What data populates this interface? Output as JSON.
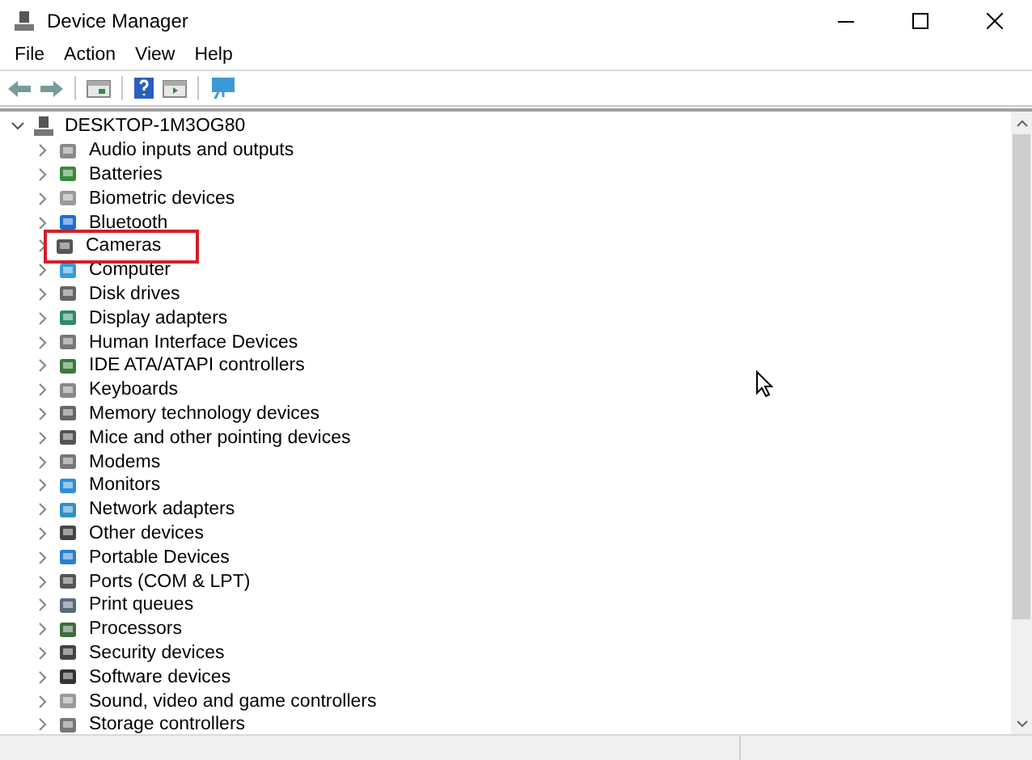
{
  "window": {
    "title": "Device Manager"
  },
  "menu": [
    "File",
    "Action",
    "View",
    "Help"
  ],
  "tree": {
    "label": "DESKTOP-1M3OG80",
    "expanded": true,
    "children": [
      {
        "label": "Audio inputs and outputs",
        "expanded": false,
        "highlighted": false
      },
      {
        "label": "Batteries",
        "expanded": false,
        "highlighted": false
      },
      {
        "label": "Biometric devices",
        "expanded": false,
        "highlighted": false
      },
      {
        "label": "Bluetooth",
        "expanded": false,
        "highlighted": false
      },
      {
        "label": "Cameras",
        "expanded": false,
        "highlighted": true
      },
      {
        "label": "Computer",
        "expanded": false,
        "highlighted": false
      },
      {
        "label": "Disk drives",
        "expanded": false,
        "highlighted": false
      },
      {
        "label": "Display adapters",
        "expanded": false,
        "highlighted": false
      },
      {
        "label": "Human Interface Devices",
        "expanded": false,
        "highlighted": false
      },
      {
        "label": "IDE ATA/ATAPI controllers",
        "expanded": false,
        "highlighted": false
      },
      {
        "label": "Keyboards",
        "expanded": false,
        "highlighted": false
      },
      {
        "label": "Memory technology devices",
        "expanded": false,
        "highlighted": false
      },
      {
        "label": "Mice and other pointing devices",
        "expanded": false,
        "highlighted": false
      },
      {
        "label": "Modems",
        "expanded": false,
        "highlighted": false
      },
      {
        "label": "Monitors",
        "expanded": false,
        "highlighted": false
      },
      {
        "label": "Network adapters",
        "expanded": false,
        "highlighted": false
      },
      {
        "label": "Other devices",
        "expanded": false,
        "highlighted": false
      },
      {
        "label": "Portable Devices",
        "expanded": false,
        "highlighted": false
      },
      {
        "label": "Ports (COM & LPT)",
        "expanded": false,
        "highlighted": false
      },
      {
        "label": "Print queues",
        "expanded": false,
        "highlighted": false
      },
      {
        "label": "Processors",
        "expanded": false,
        "highlighted": false
      },
      {
        "label": "Security devices",
        "expanded": false,
        "highlighted": false
      },
      {
        "label": "Software devices",
        "expanded": false,
        "highlighted": false
      },
      {
        "label": "Sound, video and game controllers",
        "expanded": false,
        "highlighted": false
      },
      {
        "label": "Storage controllers",
        "expanded": false,
        "highlighted": false
      }
    ]
  }
}
